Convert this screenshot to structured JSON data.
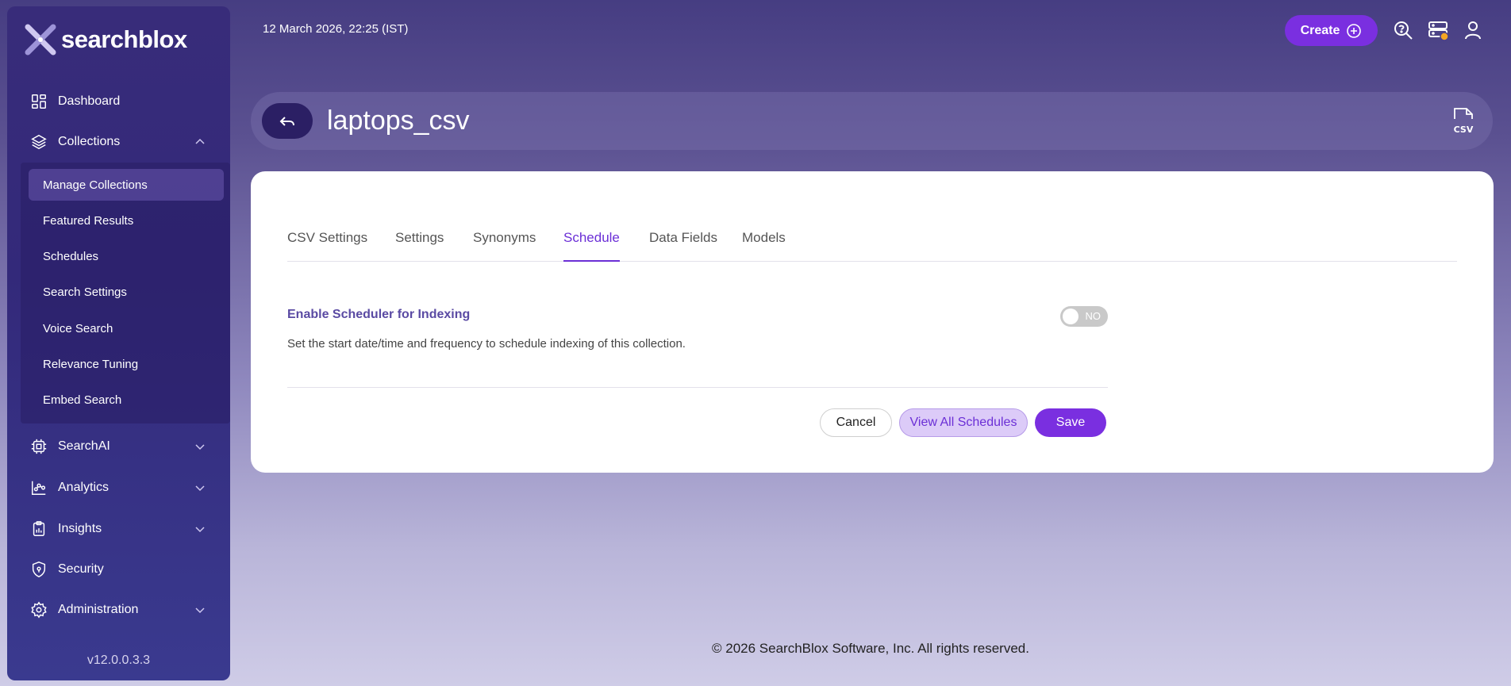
{
  "brand": {
    "name": "searchblox",
    "version": "v12.0.0.3.3"
  },
  "topbar": {
    "datetime": "12 March 2026, 22:25 (IST)",
    "create_label": "Create"
  },
  "sidebar": {
    "items": [
      {
        "label": "Dashboard",
        "icon": "dashboard-icon"
      },
      {
        "label": "Collections",
        "icon": "layers-icon",
        "expanded": true
      },
      {
        "label": "SearchAI",
        "icon": "chip-icon"
      },
      {
        "label": "Analytics",
        "icon": "analytics-icon"
      },
      {
        "label": "Insights",
        "icon": "clipboard-icon"
      },
      {
        "label": "Security",
        "icon": "shield-icon"
      },
      {
        "label": "Administration",
        "icon": "gear-icon"
      }
    ],
    "collections_sub": [
      {
        "label": "Manage Collections",
        "active": true
      },
      {
        "label": "Featured Results"
      },
      {
        "label": "Schedules"
      },
      {
        "label": "Search Settings"
      },
      {
        "label": "Voice Search"
      },
      {
        "label": "Relevance Tuning"
      },
      {
        "label": "Embed Search"
      }
    ]
  },
  "page": {
    "title": "laptops_csv",
    "type_icon": "csv-file-icon",
    "type_icon_text": "CSV"
  },
  "tabs": [
    {
      "label": "CSV Settings"
    },
    {
      "label": "Settings"
    },
    {
      "label": "Synonyms"
    },
    {
      "label": "Schedule",
      "active": true
    },
    {
      "label": "Data Fields"
    },
    {
      "label": "Models"
    }
  ],
  "schedule": {
    "label": "Enable Scheduler for Indexing",
    "description": "Set the start date/time and frequency to schedule indexing of this collection.",
    "toggle_text": "NO",
    "enabled": false
  },
  "buttons": {
    "cancel": "Cancel",
    "view_all": "View All Schedules",
    "save": "Save"
  },
  "footer": "© 2026 SearchBlox Software, Inc. All rights reserved.",
  "colors": {
    "accent": "#7a2fe0",
    "sidebar": "#33297a",
    "tab_active": "#6b2fd6"
  }
}
